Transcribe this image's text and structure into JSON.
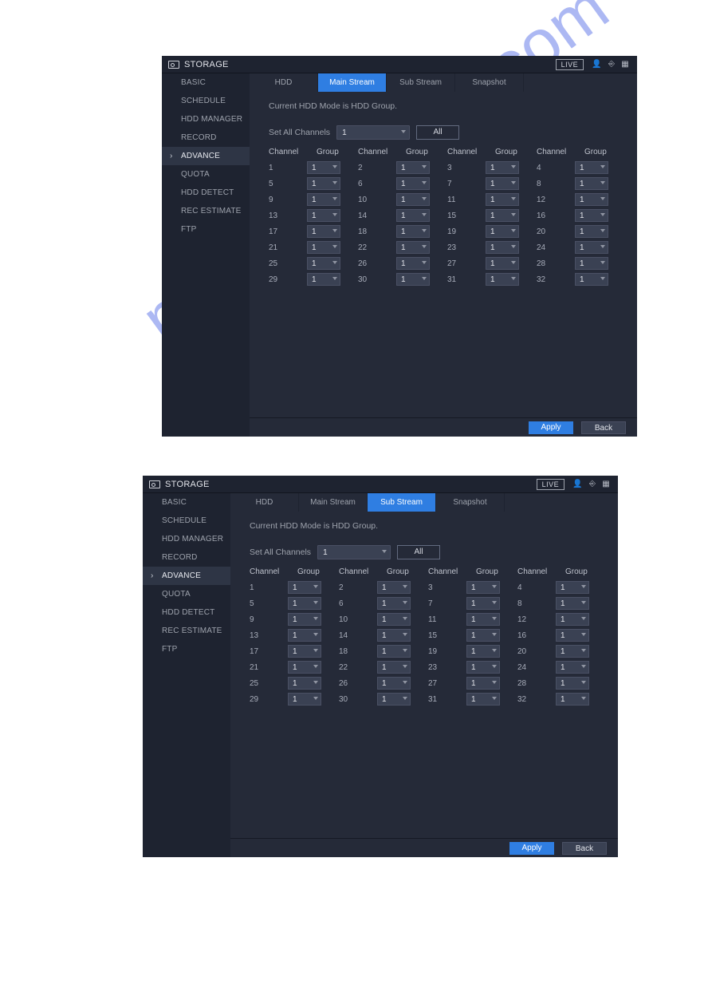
{
  "watermark_text": "manualsdrive.com",
  "common": {
    "title": "STORAGE",
    "live_label": "LIVE",
    "sidebar": [
      {
        "id": "basic",
        "label": "BASIC"
      },
      {
        "id": "schedule",
        "label": "SCHEDULE"
      },
      {
        "id": "hdd-manager",
        "label": "HDD MANAGER"
      },
      {
        "id": "record",
        "label": "RECORD"
      },
      {
        "id": "advance",
        "label": "ADVANCE",
        "active": true
      },
      {
        "id": "quota",
        "label": "QUOTA"
      },
      {
        "id": "hdd-detect",
        "label": "HDD DETECT"
      },
      {
        "id": "rec-estimate",
        "label": "REC ESTIMATE"
      },
      {
        "id": "ftp",
        "label": "FTP"
      }
    ],
    "tabs": [
      {
        "id": "hdd",
        "label": "HDD"
      },
      {
        "id": "main-stream",
        "label": "Main Stream"
      },
      {
        "id": "sub-stream",
        "label": "Sub Stream"
      },
      {
        "id": "snapshot",
        "label": "Snapshot"
      }
    ],
    "mode_text": "Current HDD Mode is HDD Group.",
    "set_all_label": "Set All Channels",
    "set_all_value": "1",
    "all_button": "All",
    "col_channel": "Channel",
    "col_group": "Group",
    "apply_label": "Apply",
    "back_label": "Back",
    "channels": [
      {
        "ch": 1,
        "grp": "1"
      },
      {
        "ch": 2,
        "grp": "1"
      },
      {
        "ch": 3,
        "grp": "1"
      },
      {
        "ch": 4,
        "grp": "1"
      },
      {
        "ch": 5,
        "grp": "1"
      },
      {
        "ch": 6,
        "grp": "1"
      },
      {
        "ch": 7,
        "grp": "1"
      },
      {
        "ch": 8,
        "grp": "1"
      },
      {
        "ch": 9,
        "grp": "1"
      },
      {
        "ch": 10,
        "grp": "1"
      },
      {
        "ch": 11,
        "grp": "1"
      },
      {
        "ch": 12,
        "grp": "1"
      },
      {
        "ch": 13,
        "grp": "1"
      },
      {
        "ch": 14,
        "grp": "1"
      },
      {
        "ch": 15,
        "grp": "1"
      },
      {
        "ch": 16,
        "grp": "1"
      },
      {
        "ch": 17,
        "grp": "1"
      },
      {
        "ch": 18,
        "grp": "1"
      },
      {
        "ch": 19,
        "grp": "1"
      },
      {
        "ch": 20,
        "grp": "1"
      },
      {
        "ch": 21,
        "grp": "1"
      },
      {
        "ch": 22,
        "grp": "1"
      },
      {
        "ch": 23,
        "grp": "1"
      },
      {
        "ch": 24,
        "grp": "1"
      },
      {
        "ch": 25,
        "grp": "1"
      },
      {
        "ch": 26,
        "grp": "1"
      },
      {
        "ch": 27,
        "grp": "1"
      },
      {
        "ch": 28,
        "grp": "1"
      },
      {
        "ch": 29,
        "grp": "1"
      },
      {
        "ch": 30,
        "grp": "1"
      },
      {
        "ch": 31,
        "grp": "1"
      },
      {
        "ch": 32,
        "grp": "1"
      }
    ]
  },
  "screens": [
    {
      "active_tab": "main-stream"
    },
    {
      "active_tab": "sub-stream"
    }
  ]
}
